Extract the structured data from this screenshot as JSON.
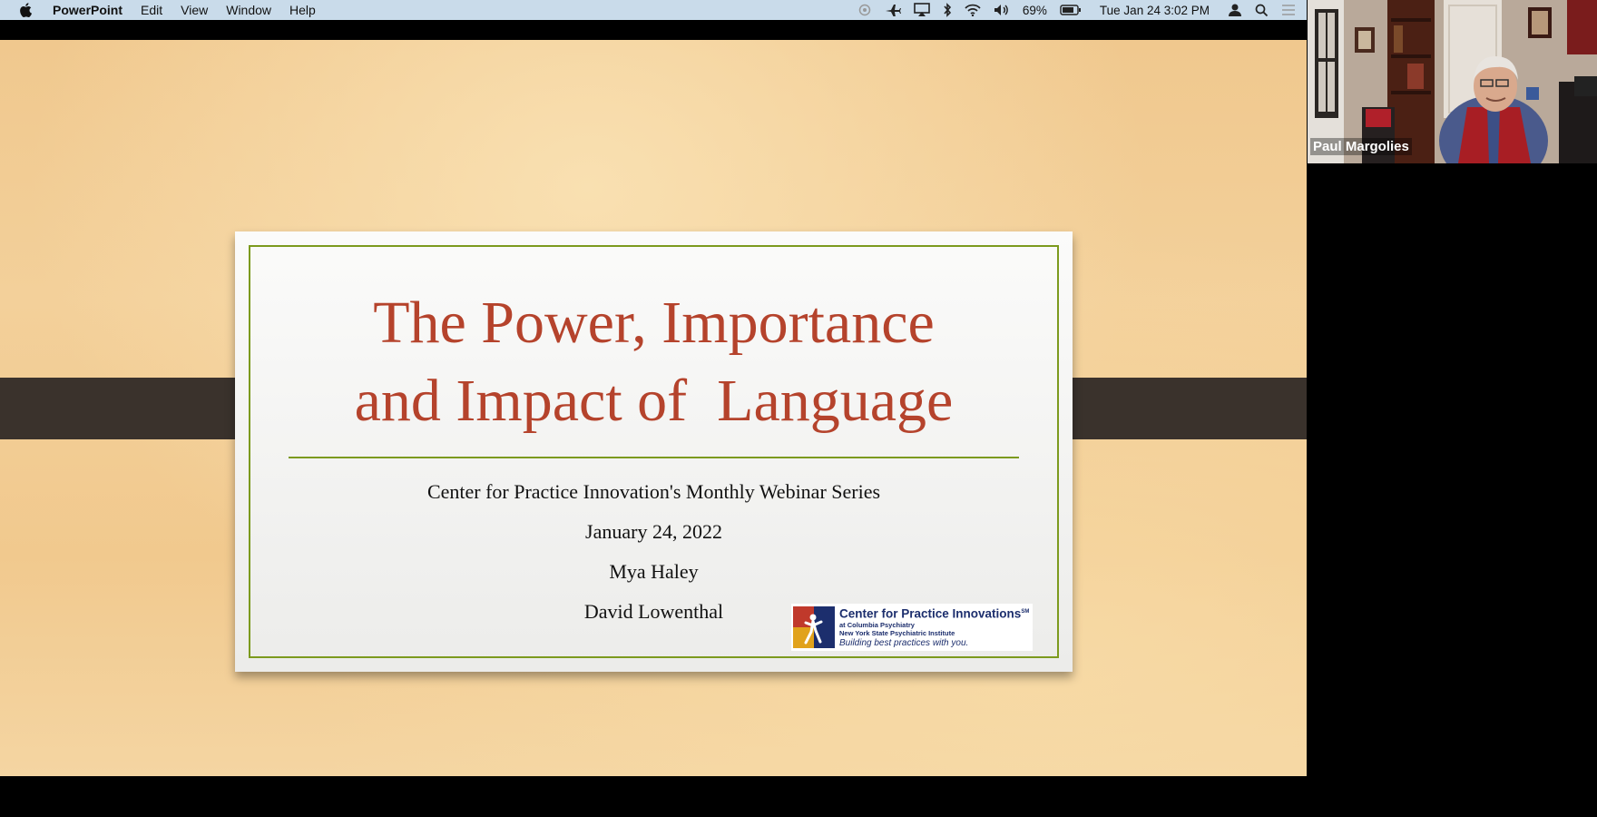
{
  "menubar": {
    "app_name": "PowerPoint",
    "menus": [
      "Edit",
      "View",
      "Window",
      "Help"
    ],
    "battery": "69%",
    "datetime": "Tue Jan 24  3:02 PM"
  },
  "slide": {
    "title_line1": "The Power, Importance",
    "title_line2": "and Impact of  Language",
    "subtitle": "Center for Practice Innovation's Monthly Webinar Series",
    "date": "January 24, 2022",
    "presenter1": "Mya Haley",
    "presenter2": "David Lowenthal",
    "logo": {
      "name": "Center for Practice Innovations",
      "mark": "SM",
      "line1": "at Columbia Psychiatry",
      "line2": "New York State Psychiatric Institute",
      "tagline": "Building best practices with you."
    }
  },
  "participant": {
    "name": "Paul Margolies"
  },
  "colors": {
    "title_red": "#b5432c",
    "border_green": "#7c9a1e",
    "logo_blue": "#1c2e6d"
  }
}
